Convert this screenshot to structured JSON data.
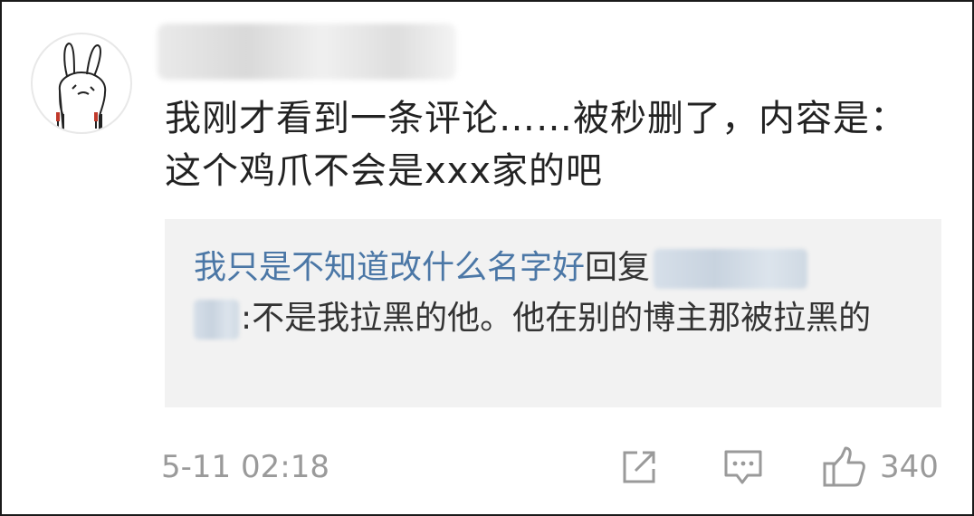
{
  "comment": {
    "author_masked": "",
    "text": "我刚才看到一条评论……被秒删了，内容是：这个鸡爪不会是xxx家的吧",
    "avatar_icon": "bunny-avatar-icon"
  },
  "reply": {
    "author": "我只是不知道改什么名字好",
    "reply_word": "回复",
    "target_masked": "",
    "colon": ":",
    "text": "不是我拉黑的他。他在别的博主那被拉黑的",
    "author_color": "#4b77a6"
  },
  "footer": {
    "timestamp": "5-11 02:18",
    "share_icon": "share-icon",
    "comment_icon": "comment-icon",
    "like_icon": "thumbs-up-icon",
    "like_count": "340"
  },
  "colors": {
    "text": "#222222",
    "muted": "#9a9a9a",
    "reply_bg": "#f2f2f2"
  }
}
